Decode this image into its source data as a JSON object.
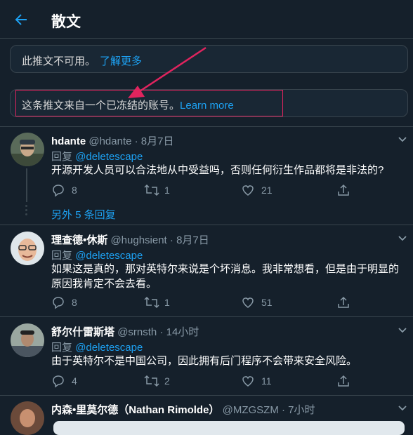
{
  "header": {
    "title": "散文"
  },
  "notices": [
    {
      "text": "此推文不可用。",
      "link": "了解更多"
    },
    {
      "text": "这条推文来自一个已冻结的账号。",
      "link": "Learn more"
    }
  ],
  "tweets": [
    {
      "name": "hdante",
      "handle": "@hdante",
      "sep": "·",
      "time": "8月7日",
      "reply_prefix": "回复",
      "reply_to": "@deletescape",
      "body": "开源开发人员可以合法地从中受益吗，否则任何衍生作品都将是非法的?",
      "replies": "8",
      "retweets": "1",
      "likes": "21"
    },
    {
      "name": "理查德•休斯",
      "handle": "@hughsient",
      "sep": "·",
      "time": "8月7日",
      "reply_prefix": "回复",
      "reply_to": "@deletescape",
      "body": "如果这是真的，那对英特尔来说是个坏消息。我非常想看，但是由于明显的原因我肯定不会去看。",
      "replies": "8",
      "retweets": "1",
      "likes": "51"
    },
    {
      "name": "舒尔什雷斯塔",
      "handle": "@srnsth",
      "sep": "·",
      "time": "14小时",
      "reply_prefix": "回复",
      "reply_to": "@deletescape",
      "body": "由于英特尔不是中国公司，因此拥有后门程序不会带来安全风险。",
      "replies": "4",
      "retweets": "2",
      "likes": "11"
    },
    {
      "name": "内森•里莫尔德（Nathan Rimolde）",
      "handle": "@MZGSZM",
      "sep": "·",
      "time": "7小时"
    }
  ],
  "more_replies": "另外 5 条回复",
  "icons": {
    "back": "arrow-left-icon",
    "reply": "reply-icon",
    "retweet": "retweet-icon",
    "like": "heart-icon",
    "share": "share-icon",
    "more": "chevron-down-icon"
  },
  "colors": {
    "background": "#15202b",
    "accent": "#1da1f2",
    "border": "#38444d",
    "secondary": "#8899a6",
    "annotation": "#e0245e"
  }
}
